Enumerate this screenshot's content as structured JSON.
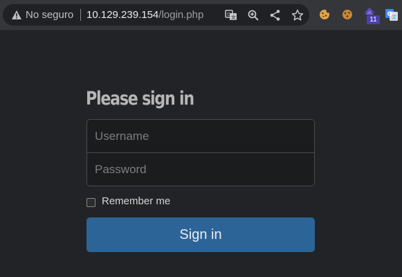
{
  "browser": {
    "security_label": "No seguro",
    "url_host": "10.129.239.154",
    "url_path": "/login.php",
    "extension_badge": "11",
    "actions": [
      "translate-icon",
      "zoom-icon",
      "share-icon",
      "bookmark-star-icon"
    ],
    "extensions": [
      "cookie-extension-icon",
      "cookie-editor-icon",
      "wappalyzer-icon",
      "google-translate-icon"
    ]
  },
  "login": {
    "heading": "Please sign in",
    "username_placeholder": "Username",
    "password_placeholder": "Password",
    "remember_label": "Remember me",
    "remember_checked": false,
    "submit_label": "Sign in"
  },
  "colors": {
    "background": "#222326",
    "button": "#2c6497",
    "heading": "#b6b6b6"
  }
}
